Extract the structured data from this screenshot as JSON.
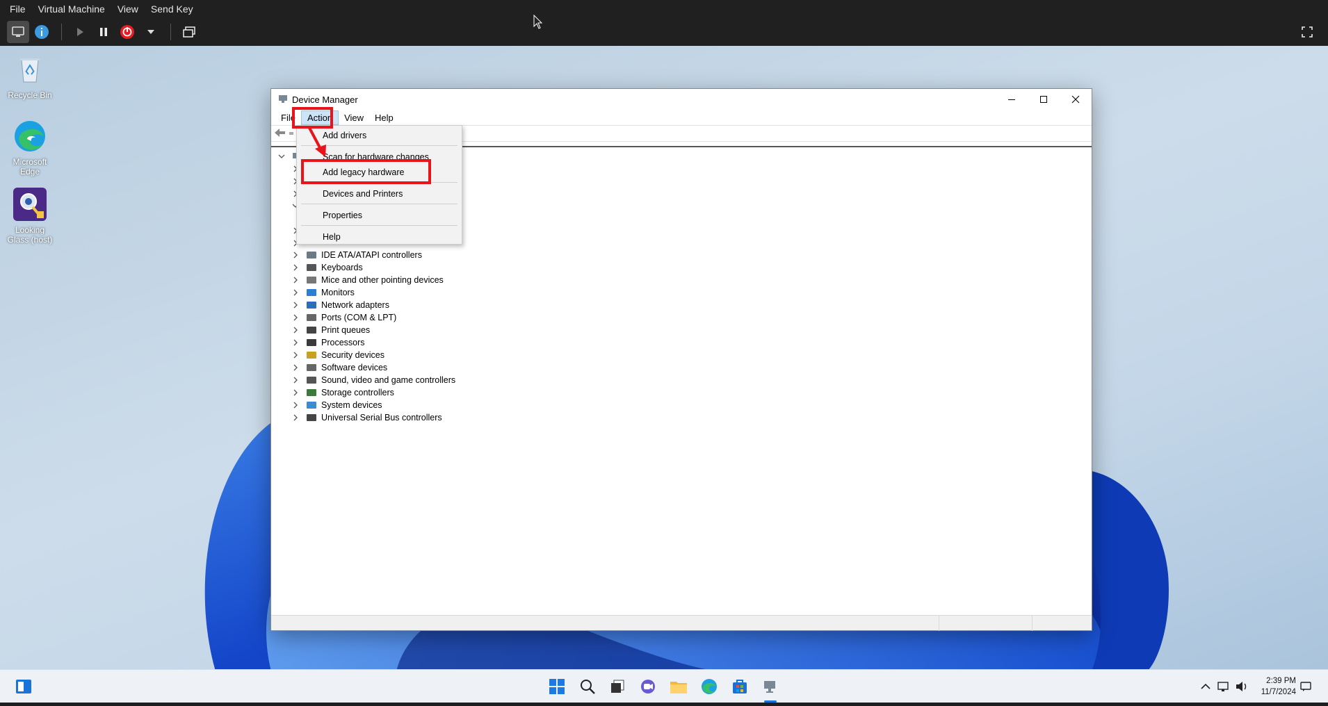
{
  "vm": {
    "menu": [
      "File",
      "Virtual Machine",
      "View",
      "Send Key"
    ],
    "toolbar_icons": [
      "monitor-icon",
      "info-icon",
      "play-icon",
      "pause-icon",
      "power-icon",
      "chevron-down-icon",
      "window-icon"
    ],
    "fullscreen_icon": "fullscreen-icon"
  },
  "desktop": {
    "icons": [
      {
        "label_1": "Recycle Bin",
        "label_2": "",
        "icon": "recycle-bin-icon"
      },
      {
        "label_1": "Microsoft",
        "label_2": "Edge",
        "icon": "edge-icon"
      },
      {
        "label_1": "Looking",
        "label_2": "Glass (host)",
        "icon": "looking-glass-icon"
      }
    ]
  },
  "window": {
    "title": "Device Manager",
    "menu": [
      "File",
      "Action",
      "View",
      "Help"
    ],
    "tree": [
      "IDE ATA/ATAPI controllers",
      "Keyboards",
      "Mice and other pointing devices",
      "Monitors",
      "Network adapters",
      "Ports (COM & LPT)",
      "Print queues",
      "Processors",
      "Security devices",
      "Software devices",
      "Sound, video and game controllers",
      "Storage controllers",
      "System devices",
      "Universal Serial Bus controllers"
    ]
  },
  "action_menu": {
    "items": [
      "Add drivers",
      "Scan for hardware changes",
      "Add legacy hardware",
      "Devices and Printers",
      "Properties",
      "Help"
    ],
    "highlighted": "Add legacy hardware"
  },
  "taskbar": {
    "time": "2:39 PM",
    "date": "11/7/2024",
    "apps": [
      "start-icon",
      "search-icon",
      "task-view-icon",
      "chat-icon",
      "file-explorer-icon",
      "edge-icon",
      "store-icon",
      "device-manager-icon"
    ]
  },
  "colors": {
    "annotation_red": "#e8141c",
    "menu_highlight": "#cce4f7",
    "vm_chrome": "#202020"
  }
}
